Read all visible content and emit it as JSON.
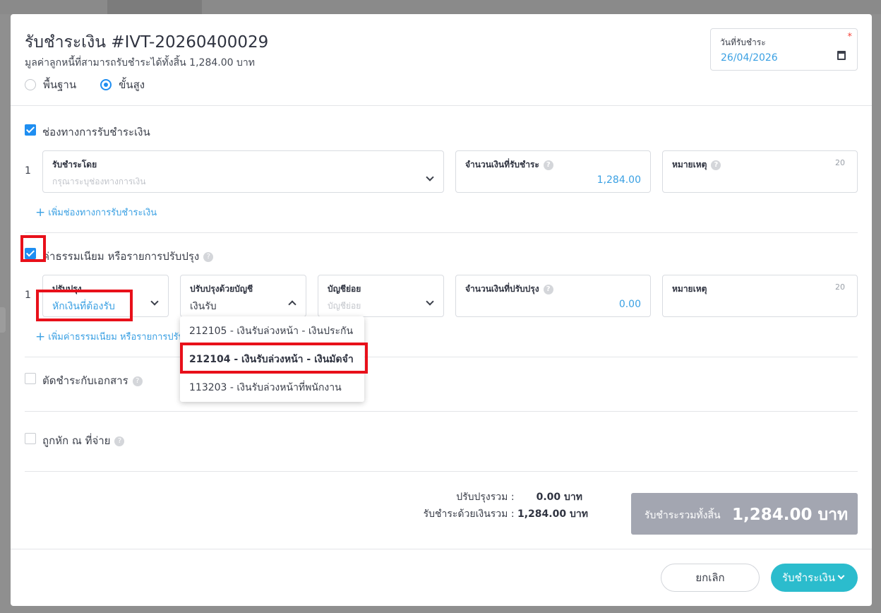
{
  "header": {
    "title": "รับชำระเงิน #IVT-20260400029",
    "subtitle": "มูลค่าลูกหนี้ที่สามารถรับชำระได้ทั้งสิ้น 1,284.00 บาท",
    "modes": [
      "พื้นฐาน",
      "ขั้นสูง"
    ],
    "selected_mode": "ขั้นสูง"
  },
  "date": {
    "label": "วันที่รับชำระ",
    "required_mark": "*",
    "value": "26/04/2026",
    "icon": "calendar-icon"
  },
  "payment": {
    "section_label": "ช่องทางการรับชำระเงิน",
    "checked": true,
    "row_number": "1",
    "method_label": "รับชำระโดย",
    "method_placeholder": "กรุณาระบุช่องทางการเงิน",
    "amount_label": "จำนวนเงินที่รับชำระ",
    "amount_value": "1,284.00",
    "note_label": "หมายเหตุ",
    "note_count": "20",
    "add_link": "เพิ่มช่องทางการรับชำระเงิน"
  },
  "adjustment": {
    "section_label": "ค่าธรรมเนียม หรือรายการปรับปรุง",
    "checked": true,
    "row_number": "1",
    "type_label": "ปรับปรุง",
    "type_value": "หักเงินที่ต้องรับ",
    "account_label": "ปรับปรุงด้วยบัญชี",
    "account_value": "เงินรับ",
    "sub_label": "บัญชีย่อย",
    "sub_placeholder": "บัญชีย่อย",
    "amount_label": "จำนวนเงินที่ปรับปรุง",
    "amount_value": "0.00",
    "note_label": "หมายเหตุ",
    "note_count": "20",
    "add_link": "เพิ่มค่าธรรมเนียม หรือรายการปรับปรุง",
    "dropdown_options": [
      "212105 - เงินรับล่วงหน้า - เงินประกัน",
      "212104 - เงินรับล่วงหน้า - เงินมัดจำ",
      "113203 - เงินรับล่วงหน้าที่พนักงาน"
    ],
    "highlighted_option": "212104 - เงินรับล่วงหน้า - เงินมัดจำ"
  },
  "offset": {
    "label": "ตัดชำระกับเอกสาร",
    "checked": false
  },
  "withholding": {
    "label": "ถูกหัก ณ ที่จ่าย",
    "checked": false
  },
  "totals": {
    "adjust_label": "ปรับปรุงรวม :",
    "adjust_value": "0.00 บาท",
    "paid_label": "รับชำระด้วยเงินรวม :",
    "paid_value": "1,284.00 บาท",
    "grand_label": "รับชำระรวมทั้งสิ้น",
    "grand_value": "1,284.00 บาท"
  },
  "footer": {
    "cancel_label": "ยกเลิก",
    "submit_label": "รับชำระเงิน"
  },
  "colors": {
    "accent": "#1f8ef1",
    "link": "#3aa0e3",
    "submit": "#2bbccd",
    "grand_bg": "#a3a6b1",
    "highlight": "#e8101a"
  }
}
